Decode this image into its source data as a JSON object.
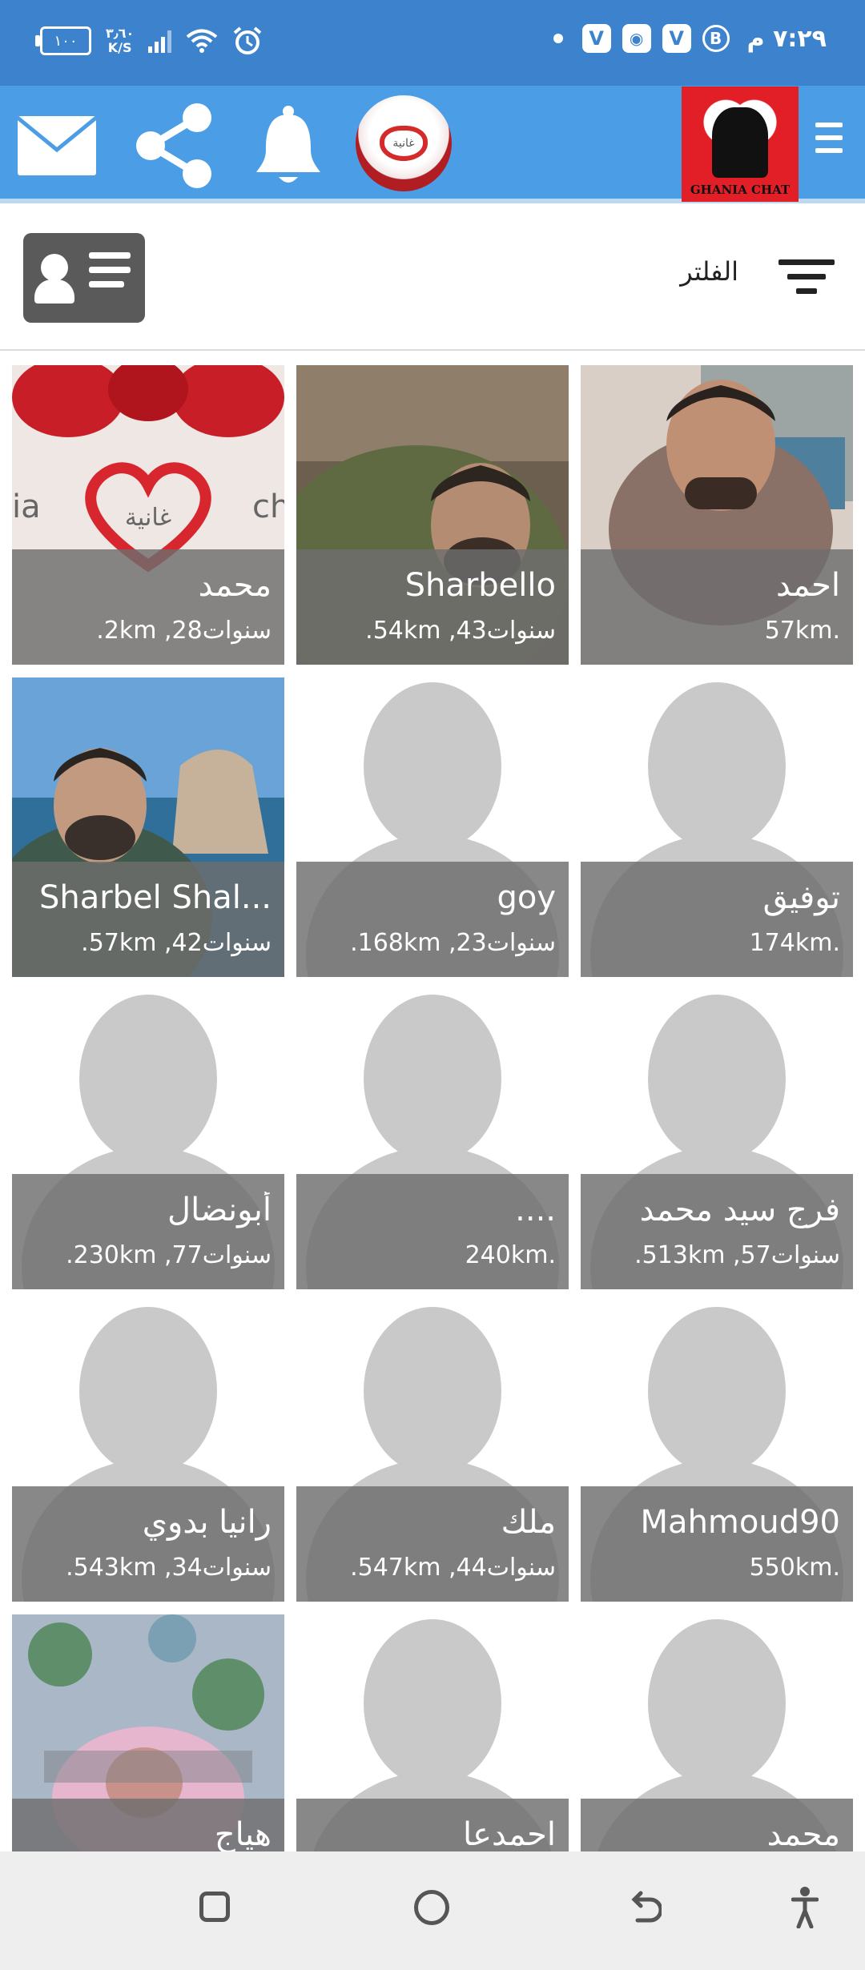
{
  "status_bar": {
    "battery": "١٠٠",
    "speed_value": "٣٫٦٠",
    "speed_unit": "K/S",
    "time": "٧:٢٩ م",
    "icons": [
      "signal-icon",
      "wifi-icon",
      "alarm-icon",
      "dot-icon",
      "app-v-icon",
      "gamepad-icon",
      "app-v-icon",
      "b-circle-icon"
    ]
  },
  "app_bar": {
    "icons": [
      "mail-icon",
      "share-icon",
      "bell-icon",
      "profile-logo",
      "brand-logo",
      "menu-icon"
    ],
    "brand_text": "GHANIA CHAT",
    "profile_logo_text": "غانية",
    "accent_color": "#4b9de6"
  },
  "filter_bar": {
    "filter_label": "الفلتر"
  },
  "users": [
    {
      "name": "احمد",
      "meta": "57km.",
      "photo": "man-portrait"
    },
    {
      "name": "Sharbello",
      "meta": ".54km ,43سنوات",
      "photo": "man-jacket"
    },
    {
      "name": "محمد",
      "meta": ".2km ,28سنوات",
      "photo": "ghania-logo"
    },
    {
      "name": "توفيق",
      "meta": "174km.",
      "photo": "placeholder"
    },
    {
      "name": "goy",
      "meta": ".168km ,23سنوات",
      "photo": "placeholder"
    },
    {
      "name": "Sharbel Shal...",
      "meta": ".57km ,42سنوات",
      "photo": "man-sea"
    },
    {
      "name": "فرج سيد محمد",
      "meta": ".513km ,57سنوات",
      "photo": "placeholder"
    },
    {
      "name": "....",
      "meta": "240km.",
      "photo": "placeholder"
    },
    {
      "name": "أبونضال",
      "meta": ".230km ,77سنوات",
      "photo": "placeholder"
    },
    {
      "name": "Mahmoud90",
      "meta": "550km.",
      "photo": "placeholder"
    },
    {
      "name": "ملك",
      "meta": ".547km ,44سنوات",
      "photo": "placeholder"
    },
    {
      "name": "رانيا بدوي",
      "meta": ".543km ,34سنوات",
      "photo": "placeholder"
    },
    {
      "name": "محمد",
      "meta": "",
      "photo": "placeholder"
    },
    {
      "name": "احمدعا",
      "meta": "",
      "photo": "placeholder"
    },
    {
      "name": "هياج",
      "meta": "",
      "photo": "baby"
    }
  ],
  "nav_bar": {
    "icons": [
      "recent-apps-icon",
      "home-icon",
      "back-icon",
      "accessibility-icon"
    ]
  }
}
